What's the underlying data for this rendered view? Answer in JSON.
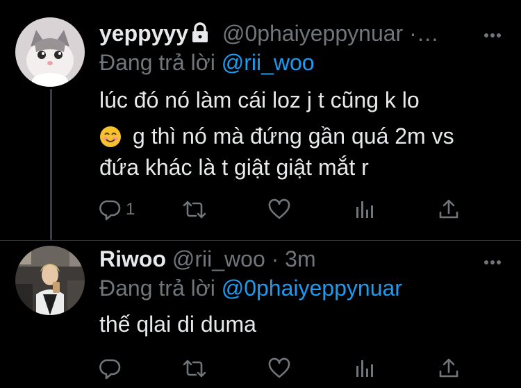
{
  "tweets": [
    {
      "display_name": "yeppyyy",
      "handle": "@0phaiyeppynuar",
      "separator": "·",
      "time": "…",
      "replying_prefix": "Đang trả lời",
      "replying_to": "@rii_woo",
      "lines": [
        "lúc đó nó làm cái loz j t cũng k lo",
        "g thì nó mà đứng gần quá 2m vs",
        "đứa khác là t giật giật mắt r"
      ],
      "emoji": "😊",
      "reply_count": "1",
      "protected": true
    },
    {
      "display_name": "Riwoo",
      "handle": "@rii_woo",
      "separator": "·",
      "time": "3m",
      "replying_prefix": "Đang trả lời",
      "replying_to": "@0phaiyeppynuar",
      "lines": [
        "thế qlai di duma"
      ],
      "reply_count": ""
    }
  ],
  "colors": {
    "background": "#000000",
    "text": "#e7e9ea",
    "muted": "#71767b",
    "link": "#1d9bf0"
  },
  "icons": [
    "lock-icon",
    "more-icon",
    "reply-icon",
    "retweet-icon",
    "like-icon",
    "analytics-icon",
    "share-icon",
    "emoji-icon"
  ]
}
